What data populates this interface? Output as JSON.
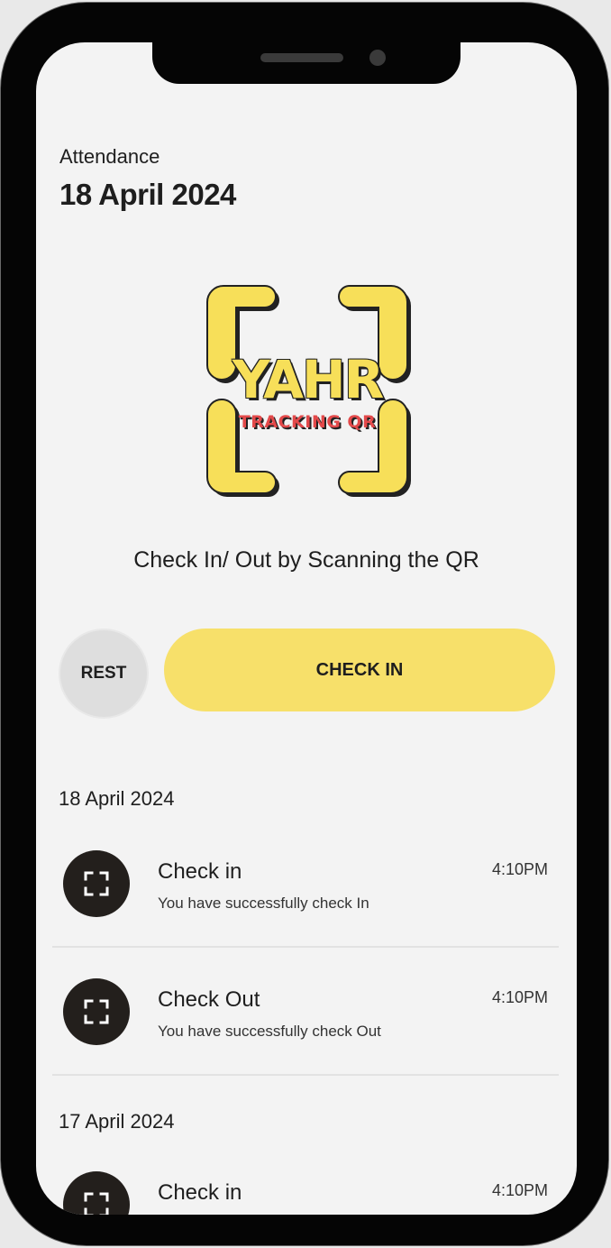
{
  "attendance": {
    "label": "Attendance",
    "date": "18 April 2024"
  },
  "logo": {
    "title": "YAHR",
    "subtitle": "TRACKING QR",
    "colors": {
      "yellow": "#f7df59",
      "red": "#e3494a",
      "outline": "#222222"
    }
  },
  "scan_caption": "Check In/ Out by Scanning the QR",
  "buttons": {
    "rest_label": "REST",
    "checkin_label": "CHECK IN",
    "accent": "#f7e06a"
  },
  "history": [
    {
      "date": "18 April 2024",
      "entries": [
        {
          "title": "Check in",
          "subtitle": "You have successfully check In",
          "time": "4:10PM",
          "icon": "scan-icon"
        },
        {
          "title": "Check Out",
          "subtitle": "You have successfully check Out",
          "time": "4:10PM",
          "icon": "scan-icon"
        }
      ]
    },
    {
      "date": "17 April 2024",
      "entries": [
        {
          "title": "Check in",
          "subtitle": "",
          "time": "4:10PM",
          "icon": "scan-icon"
        }
      ]
    }
  ]
}
